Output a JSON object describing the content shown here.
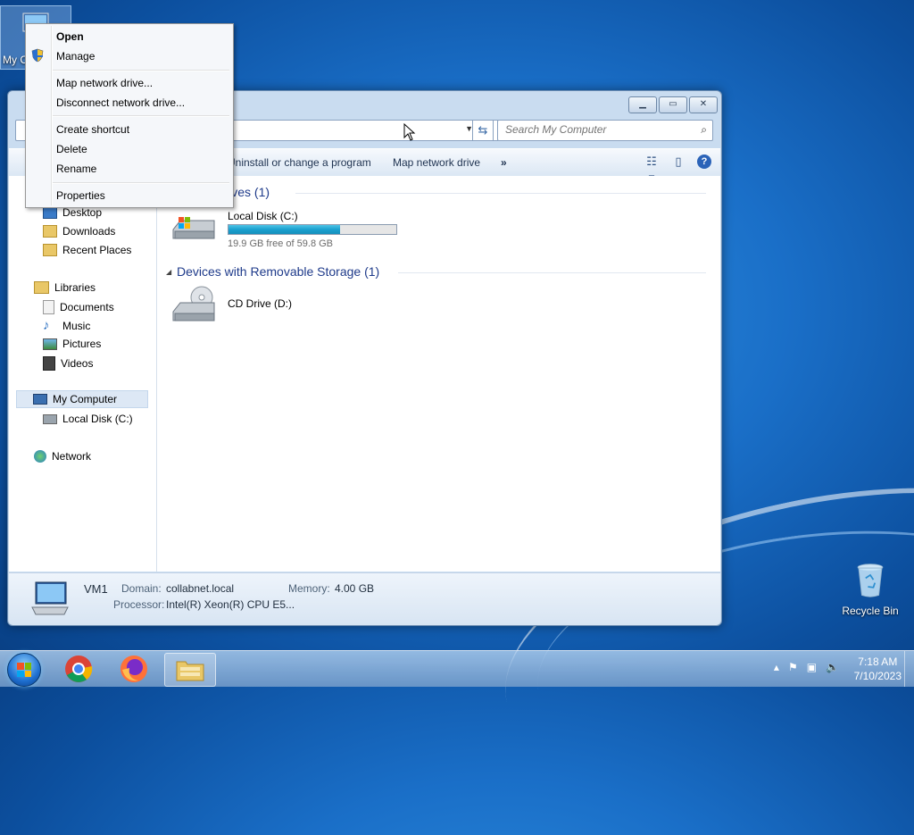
{
  "desktop": {
    "my_computer_label": "My Computer",
    "recycle_bin_label": "Recycle Bin"
  },
  "context_menu": {
    "items": [
      "Open",
      "Manage",
      "Map network drive...",
      "Disconnect network drive...",
      "Create shortcut",
      "Delete",
      "Rename",
      "Properties"
    ]
  },
  "explorer": {
    "search_placeholder": "Search My Computer",
    "commands": [
      "Uninstall or change a program",
      "Map network drive",
      "»"
    ],
    "nav": {
      "favorites": [
        "Desktop",
        "Downloads",
        "Recent Places"
      ],
      "libraries": "Libraries",
      "library_items": [
        "Documents",
        "Music",
        "Pictures",
        "Videos"
      ],
      "computer": "My Computer",
      "computer_items": [
        "Local Disk (C:)"
      ],
      "network": "Network"
    },
    "groups": {
      "hard_drives": "Hard Disk Drives (1)",
      "removable": "Devices with Removable Storage (1)"
    },
    "drives": {
      "c_name": "Local Disk (C:)",
      "c_free": "19.9 GB free of 59.8 GB",
      "c_used_fraction": 0.667,
      "d_name": "CD Drive (D:)"
    },
    "status": {
      "name": "VM1",
      "domain_label": "Domain:",
      "domain_value": "collabnet.local",
      "memory_label": "Memory:",
      "memory_value": "4.00 GB",
      "processor_label": "Processor:",
      "processor_value": "Intel(R) Xeon(R) CPU E5..."
    }
  },
  "taskbar": {
    "time": "7:18 AM",
    "date": "7/10/2023"
  },
  "colors": {
    "accent": "#1e3a8a",
    "bar_fill": "#1aa0cf"
  }
}
